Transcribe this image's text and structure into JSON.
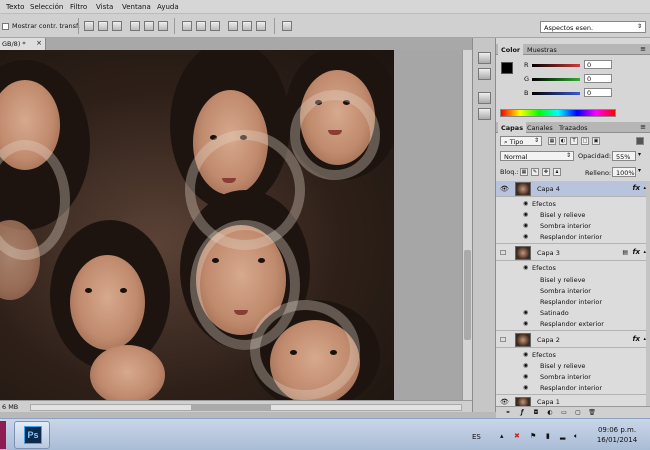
{
  "menu": [
    "Texto",
    "Selección",
    "Filtro",
    "Vista",
    "Ventana",
    "Ayuda"
  ],
  "options": {
    "show_transform_label": "Mostrar contr. transf.",
    "workspace": "Aspectos esen."
  },
  "document": {
    "tab_title": "GB/8) *",
    "close_symbol": "×",
    "status_text": "6 MB"
  },
  "color_panel": {
    "tabs": [
      "Color",
      "Muestras"
    ],
    "channels": [
      {
        "label": "R",
        "value": "0",
        "color": "#d23b3b"
      },
      {
        "label": "G",
        "value": "0",
        "color": "#2fae2f"
      },
      {
        "label": "B",
        "value": "0",
        "color": "#3b5bd2"
      }
    ],
    "foreground": "#000000",
    "background": "#ffffff"
  },
  "layers_panel": {
    "tabs": [
      "Capas",
      "Canales",
      "Trazados"
    ],
    "filter_label": "Tipo",
    "blend_mode": "Normal",
    "opacity_label": "Opacidad:",
    "opacity_value": "55%",
    "lock_label": "Bloq.:",
    "fill_label": "Relleno:",
    "fill_value": "100%",
    "layers": [
      {
        "name": "Capa 4",
        "selected": true,
        "visible": true,
        "fx": "fx",
        "effects_label": "Efectos",
        "effects": [
          {
            "name": "Bisel y relieve",
            "visible": true
          },
          {
            "name": "Sombra interior",
            "visible": true
          },
          {
            "name": "Resplandor interior",
            "visible": true
          }
        ]
      },
      {
        "name": "Capa 3",
        "selected": false,
        "visible": false,
        "fx": "fx",
        "effects_label": "Efectos",
        "effects": [
          {
            "name": "Bisel y relieve",
            "visible": false
          },
          {
            "name": "Sombra interior",
            "visible": false
          },
          {
            "name": "Resplandor interior",
            "visible": false
          },
          {
            "name": "Satinado",
            "visible": true
          },
          {
            "name": "Resplandor exterior",
            "visible": true
          }
        ]
      },
      {
        "name": "Capa 2",
        "selected": false,
        "visible": false,
        "fx": "fx",
        "effects_label": "Efectos",
        "effects": [
          {
            "name": "Bisel y relieve",
            "visible": true
          },
          {
            "name": "Sombra interior",
            "visible": true
          },
          {
            "name": "Resplandor interior",
            "visible": true
          }
        ]
      },
      {
        "name": "Capa 1",
        "selected": false,
        "visible": true,
        "fx": "",
        "effects": []
      }
    ]
  },
  "taskbar": {
    "app_label": "Ps",
    "language": "ES",
    "time": "09:06 p.m.",
    "date": "16/01/2014"
  }
}
